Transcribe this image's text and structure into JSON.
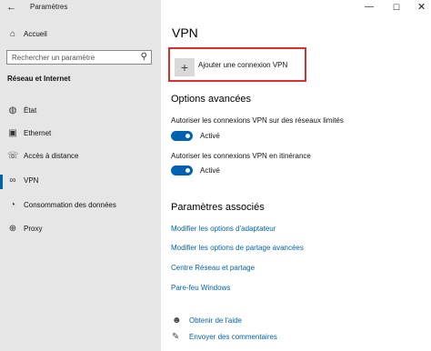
{
  "window": {
    "title": "Paramètres",
    "controls": {
      "minimize": "—",
      "maximize": "☐",
      "close": "✕"
    }
  },
  "sidebar": {
    "home": "Accueil",
    "search_placeholder": "Rechercher un paramètre",
    "section": "Réseau et Internet",
    "items": [
      {
        "label": "État"
      },
      {
        "label": "Ethernet"
      },
      {
        "label": "Accès à distance"
      },
      {
        "label": "VPN"
      },
      {
        "label": "Consommation des données"
      },
      {
        "label": "Proxy"
      }
    ]
  },
  "main": {
    "title": "VPN",
    "add_vpn": "Ajouter une connexion VPN",
    "advanced_title": "Options avancées",
    "opt1_label": "Autoriser les connexions VPN sur des réseaux limités",
    "opt1_state": "Activé",
    "opt2_label": "Autoriser les connexions VPN en itinérance",
    "opt2_state": "Activé",
    "related_title": "Paramètres associés",
    "related_links": [
      "Modifier les options d'adaptateur",
      "Modifier les options de partage avancées",
      "Centre Réseau et partage",
      "Pare-feu Windows"
    ],
    "help": "Obtenir de l'aide",
    "feedback": "Envoyer des commentaires"
  }
}
